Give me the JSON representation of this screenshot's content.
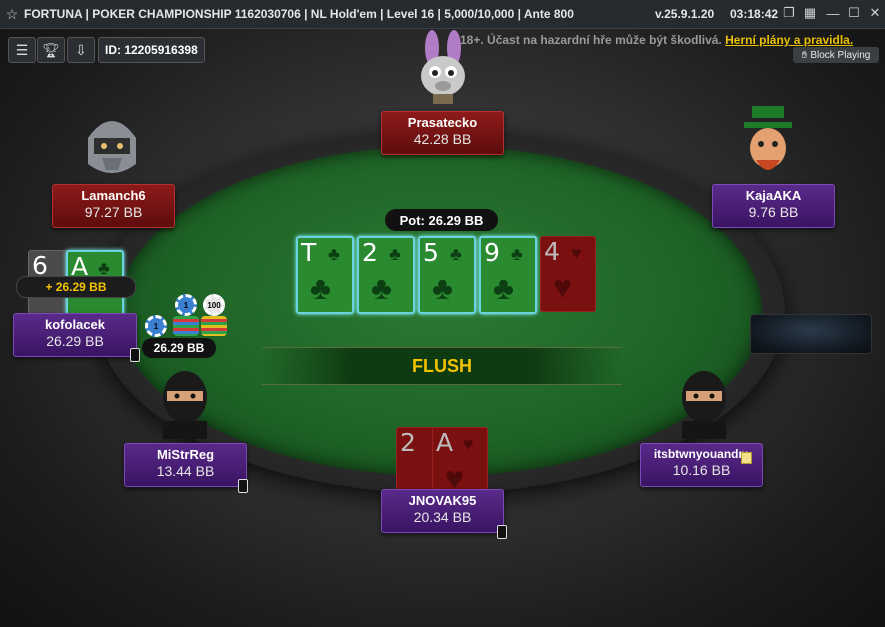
{
  "titlebar": {
    "title": "FORTUNA | POKER CHAMPIONSHIP 1162030706 | NL Hold'em | Level 16 | 5,000/10,000 | Ante 800",
    "version": "v.25.9.1.20",
    "clock": "03:18:42"
  },
  "toolbar": {
    "player_id": "ID: 12205916398"
  },
  "warning": {
    "text": "18+. Účast na hazardní hře může být škodlivá.",
    "link": "Herní plány a pravidla."
  },
  "block_playing": "Block Playing",
  "pot": "Pot: 26.29 BB",
  "board": [
    {
      "rank": "T",
      "suit": "♣"
    },
    {
      "rank": "2",
      "suit": "♣"
    },
    {
      "rank": "5",
      "suit": "♣"
    },
    {
      "rank": "9",
      "suit": "♣"
    },
    {
      "rank": "4",
      "suit": "♥"
    }
  ],
  "hand_result": "FLUSH",
  "players": {
    "top": {
      "name": "Prasatecko",
      "stack": "42.28 BB"
    },
    "top_left": {
      "name": "Lamanch6",
      "stack": "97.27 BB"
    },
    "top_right": {
      "name": "KajaAKA",
      "stack": "9.76 BB"
    },
    "left": {
      "name": "kofolacek",
      "stack": "26.29 BB",
      "win": "+ 26.29 BB",
      "cards": [
        "6",
        "A"
      ]
    },
    "bottom_left": {
      "name": "MiStrReg",
      "stack": "13.44 BB"
    },
    "bottom": {
      "name": "JNOVAK95",
      "stack": "20.34 BB",
      "cards": [
        "2",
        "A"
      ]
    },
    "bottom_right": {
      "name": "itsbtwnyouandm",
      "stack": "10.16 BB"
    }
  },
  "bet_label": "26.29 BB",
  "chips": [
    "1",
    "1",
    "100"
  ],
  "colors": {
    "felt": "#1f6427",
    "red_plate": "#8e1a1a",
    "purple_plate": "#5a2a8a",
    "accent_yellow": "#f2c300"
  }
}
